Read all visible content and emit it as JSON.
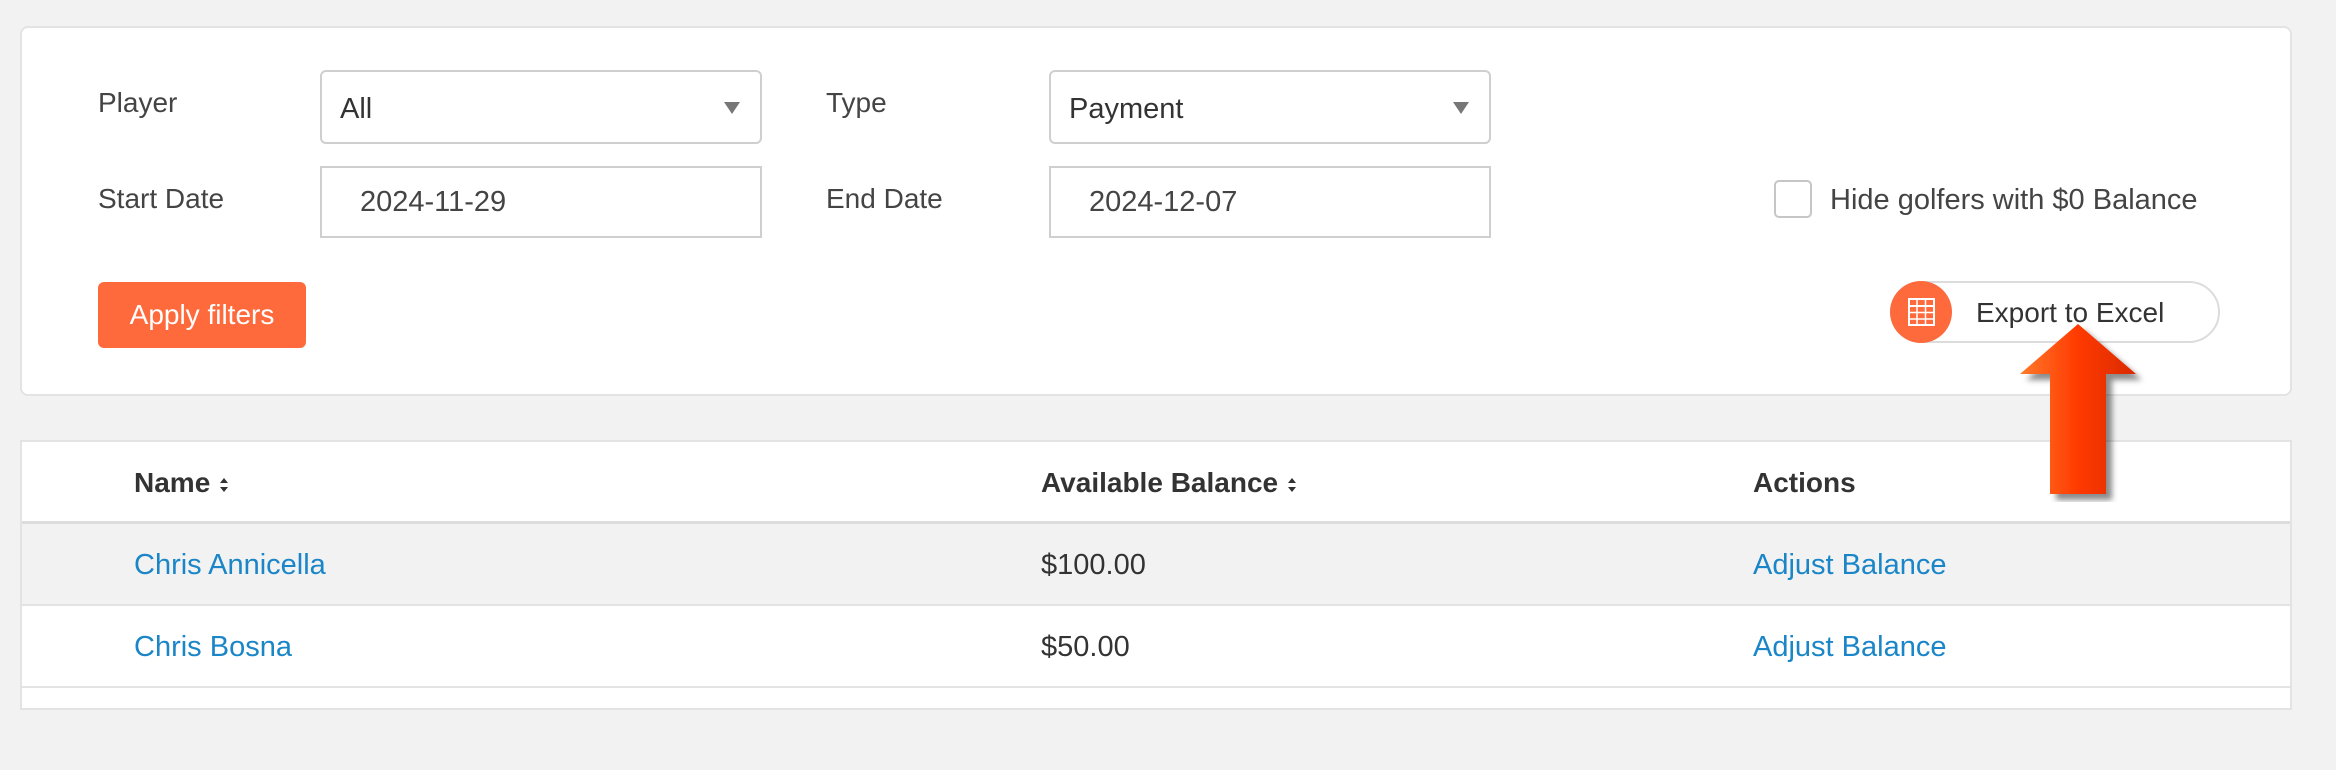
{
  "filters": {
    "player_label": "Player",
    "player_value": "All",
    "type_label": "Type",
    "type_value": "Payment",
    "start_date_label": "Start Date",
    "start_date_value": "2024-11-29",
    "end_date_label": "End Date",
    "end_date_value": "2024-12-07",
    "hide_zero_label": "Hide golfers with $0 Balance",
    "hide_zero_checked": false,
    "apply_label": "Apply filters",
    "export_label": "Export to Excel",
    "export_icon": "spreadsheet-icon"
  },
  "table": {
    "headers": {
      "name": "Name",
      "balance": "Available Balance",
      "actions": "Actions"
    },
    "rows": [
      {
        "name": "Chris Annicella",
        "balance": "$100.00",
        "action": "Adjust Balance"
      },
      {
        "name": "Chris Bosna",
        "balance": "$50.00",
        "action": "Adjust Balance"
      }
    ]
  },
  "annotation": {
    "icon": "red-arrow-pointing-up-icon"
  },
  "colors": {
    "accent": "#ff6a3d",
    "link": "#1a86c8",
    "arrow": "#ff3a00"
  }
}
